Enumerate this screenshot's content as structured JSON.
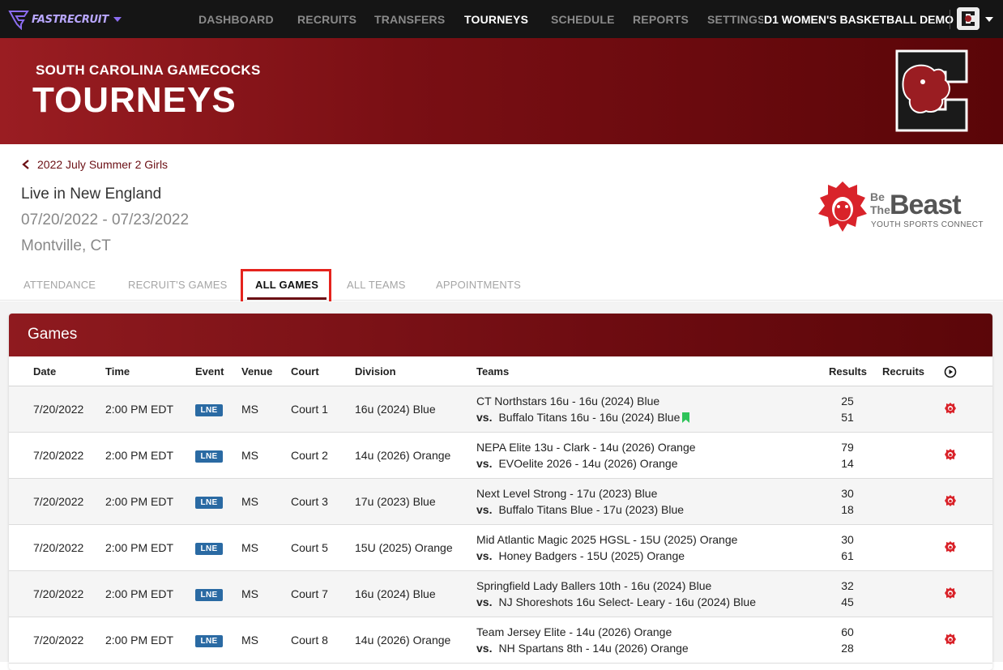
{
  "nav": {
    "logo_text": "FASTRECRUIT",
    "items": [
      "DASHBOARD",
      "RECRUITS",
      "TRANSFERS",
      "TOURNEYS",
      "SCHEDULE",
      "REPORTS",
      "SETTINGS"
    ],
    "active": "TOURNEYS",
    "team_name": "D1 WOMEN'S BASKETBALL DEMO"
  },
  "banner": {
    "school": "SOUTH CAROLINA GAMECOCKS",
    "title": "TOURNEYS"
  },
  "event": {
    "back_label": "2022 July Summer 2 Girls",
    "name": "Live in New England",
    "dates": "07/20/2022 - 07/23/2022",
    "location": "Montville, CT",
    "partner": {
      "line1": "Be",
      "line2": "The",
      "word": "Beast",
      "tagline": "YOUTH SPORTS CONNECTED"
    }
  },
  "tabs": [
    "ATTENDANCE",
    "RECRUIT'S GAMES",
    "ALL GAMES",
    "ALL TEAMS",
    "APPOINTMENTS"
  ],
  "games": {
    "title": "Games",
    "headers": {
      "date": "Date",
      "time": "Time",
      "event": "Event",
      "venue": "Venue",
      "court": "Court",
      "division": "Division",
      "teams": "Teams",
      "results": "Results",
      "recruits": "Recruits"
    },
    "vs_label": "vs.",
    "rows": [
      {
        "date": "7/20/2022",
        "time": "2:00 PM EDT",
        "event": "LNE",
        "venue": "MS",
        "court": "Court 1",
        "division": "16u (2024) Blue",
        "team1": "CT Northstars 16u - 16u (2024) Blue",
        "team2": "Buffalo Titans 16u - 16u (2024) Blue",
        "score1": "25",
        "score2": "51",
        "flag": true
      },
      {
        "date": "7/20/2022",
        "time": "2:00 PM EDT",
        "event": "LNE",
        "venue": "MS",
        "court": "Court 2",
        "division": "14u (2026) Orange",
        "team1": "NEPA Elite 13u - Clark - 14u (2026) Orange",
        "team2": "EVOelite 2026 - 14u (2026) Orange",
        "score1": "79",
        "score2": "14",
        "flag": false
      },
      {
        "date": "7/20/2022",
        "time": "2:00 PM EDT",
        "event": "LNE",
        "venue": "MS",
        "court": "Court 3",
        "division": "17u (2023) Blue",
        "team1": "Next Level Strong - 17u (2023) Blue",
        "team2": "Buffalo Titans Blue - 17u (2023) Blue",
        "score1": "30",
        "score2": "18",
        "flag": false
      },
      {
        "date": "7/20/2022",
        "time": "2:00 PM EDT",
        "event": "LNE",
        "venue": "MS",
        "court": "Court 5",
        "division": "15U (2025) Orange",
        "team1": "Mid Atlantic Magic 2025 HGSL - 15U (2025) Orange",
        "team2": "Honey Badgers - 15U (2025) Orange",
        "score1": "30",
        "score2": "61",
        "flag": false
      },
      {
        "date": "7/20/2022",
        "time": "2:00 PM EDT",
        "event": "LNE",
        "venue": "MS",
        "court": "Court 7",
        "division": "16u (2024) Blue",
        "team1": "Springfield Lady Ballers 10th - 16u (2024) Blue",
        "team2": "NJ Shoreshots 16u Select- Leary - 16u (2024) Blue",
        "score1": "32",
        "score2": "45",
        "flag": false
      },
      {
        "date": "7/20/2022",
        "time": "2:00 PM EDT",
        "event": "LNE",
        "venue": "MS",
        "court": "Court 8",
        "division": "14u (2026) Orange",
        "team1": "Team Jersey Elite - 14u (2026) Orange",
        "team2": "NH Spartans 8th - 14u (2026) Orange",
        "score1": "60",
        "score2": "28",
        "flag": false
      }
    ]
  },
  "colors": {
    "garnet": "#73000a",
    "accent_red": "#d9232a",
    "badge_blue": "#2a6aa3",
    "logo_purple": "#8b6cf0"
  }
}
